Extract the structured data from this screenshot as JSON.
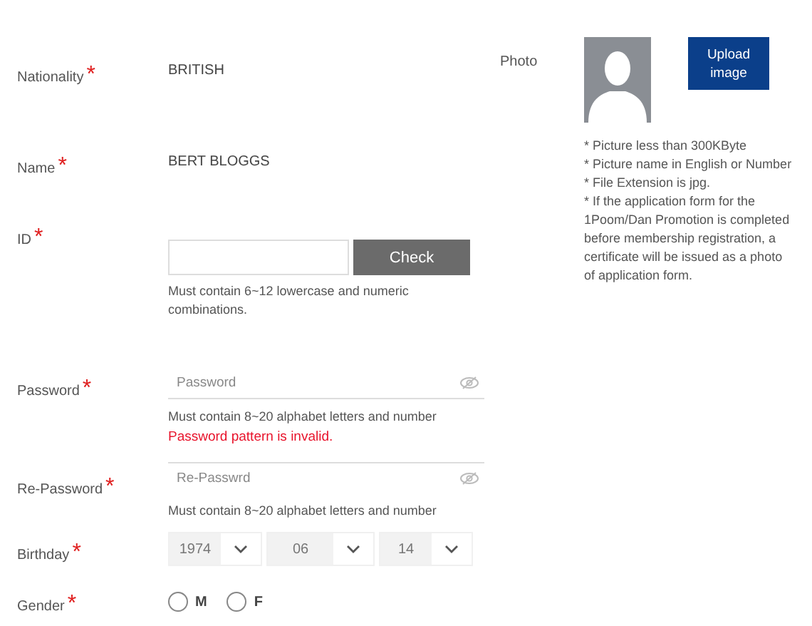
{
  "fields": [
    {
      "kind": "text",
      "label": "Nationality",
      "required_mark": "*",
      "value": "BRITISH"
    },
    {
      "kind": "text",
      "label": "Name",
      "required_mark": "*",
      "value": "BERT BLOGGS"
    },
    {
      "kind": "id_check",
      "label": "ID",
      "required_mark": "*",
      "button": "Check",
      "hint": "Must contain 6~12 lowercase and numeric combinations."
    },
    {
      "kind": "password",
      "label": "Password",
      "required_mark": "*",
      "placeholder": "Password",
      "hint": "Must contain 8~20 alphabet letters and number",
      "error": "Password pattern is invalid."
    },
    {
      "kind": "password",
      "label": "Re-Password",
      "required_mark": "*",
      "placeholder": "Re-Passwrd",
      "hint": "Must contain 8~20 alphabet letters and number"
    },
    {
      "kind": "date",
      "label": "Birthday",
      "required_mark": "*",
      "parts": [
        "1974",
        "06",
        "14"
      ]
    },
    {
      "kind": "radio",
      "label": "Gender",
      "required_mark": "*",
      "options": [
        {
          "label": "M",
          "selected": false
        },
        {
          "label": "F",
          "selected": false
        }
      ]
    }
  ],
  "photo": {
    "label": "Photo",
    "button": "Upload image",
    "notes": [
      "* Picture less than 300KByte",
      "* Picture name in English or Number",
      "* File Extension is jpg.",
      "* If the application form for the 1Poom/Dan Promotion is completed before membership registration, a certificate will be issued as a photo of application form."
    ]
  }
}
